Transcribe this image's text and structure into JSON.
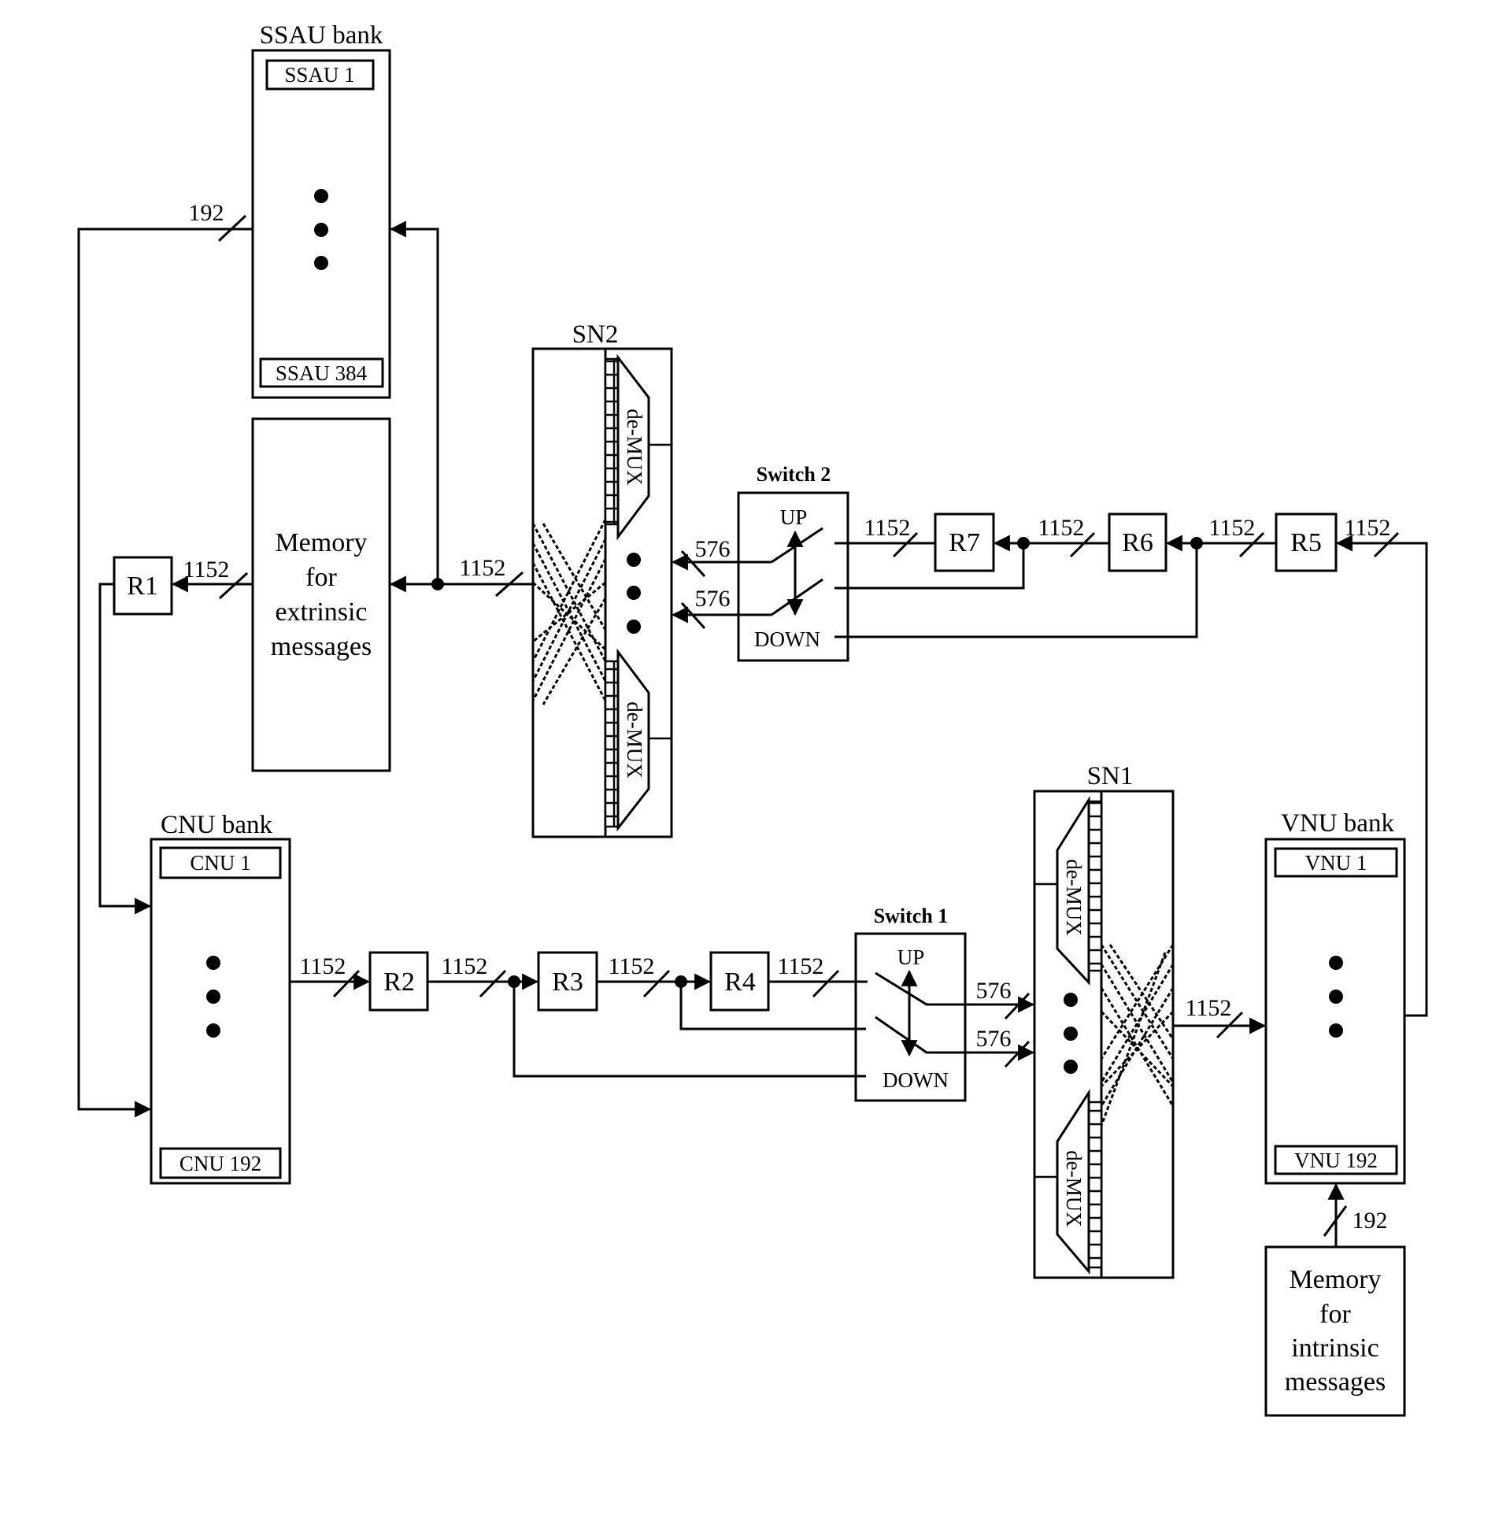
{
  "diagram": {
    "ssau_bank": {
      "title": "SSAU bank",
      "first": "SSAU 1",
      "last": "SSAU 384",
      "input_width": "192"
    },
    "memory_extrinsic": {
      "lines": [
        "Memory",
        "for",
        "extrinsic",
        "messages"
      ]
    },
    "r1": {
      "label": "R1",
      "width": "1152"
    },
    "sn2": {
      "title": "SN2",
      "demux_top": "de-MUX",
      "demux_bottom": "de-MUX",
      "input_width": "1152"
    },
    "switch2": {
      "title": "Switch 2",
      "up": "UP",
      "down": "DOWN",
      "out_top": "576",
      "out_bottom": "576"
    },
    "r7": {
      "label": "R7",
      "width": "1152"
    },
    "r6": {
      "label": "R6",
      "width": "1152"
    },
    "r5": {
      "label": "R5",
      "width_left": "1152",
      "width_right": "1152"
    },
    "cnu_bank": {
      "title": "CNU bank",
      "first": "CNU 1",
      "last": "CNU 192"
    },
    "r2": {
      "label": "R2",
      "width_in": "1152",
      "width_out": "1152"
    },
    "r3": {
      "label": "R3",
      "width_out": "1152"
    },
    "r4": {
      "label": "R4",
      "width_out": "1152"
    },
    "switch1": {
      "title": "Switch 1",
      "up": "UP",
      "down": "DOWN",
      "out_top": "576",
      "out_bottom": "576"
    },
    "sn1": {
      "title": "SN1",
      "demux_top": "de-MUX",
      "demux_bottom": "de-MUX",
      "output_width": "1152"
    },
    "vnu_bank": {
      "title": "VNU bank",
      "first": "VNU 1",
      "last": "VNU 192"
    },
    "memory_intrinsic": {
      "lines": [
        "Memory",
        "for",
        "intrinsic",
        "messages"
      ],
      "width": "192"
    }
  }
}
